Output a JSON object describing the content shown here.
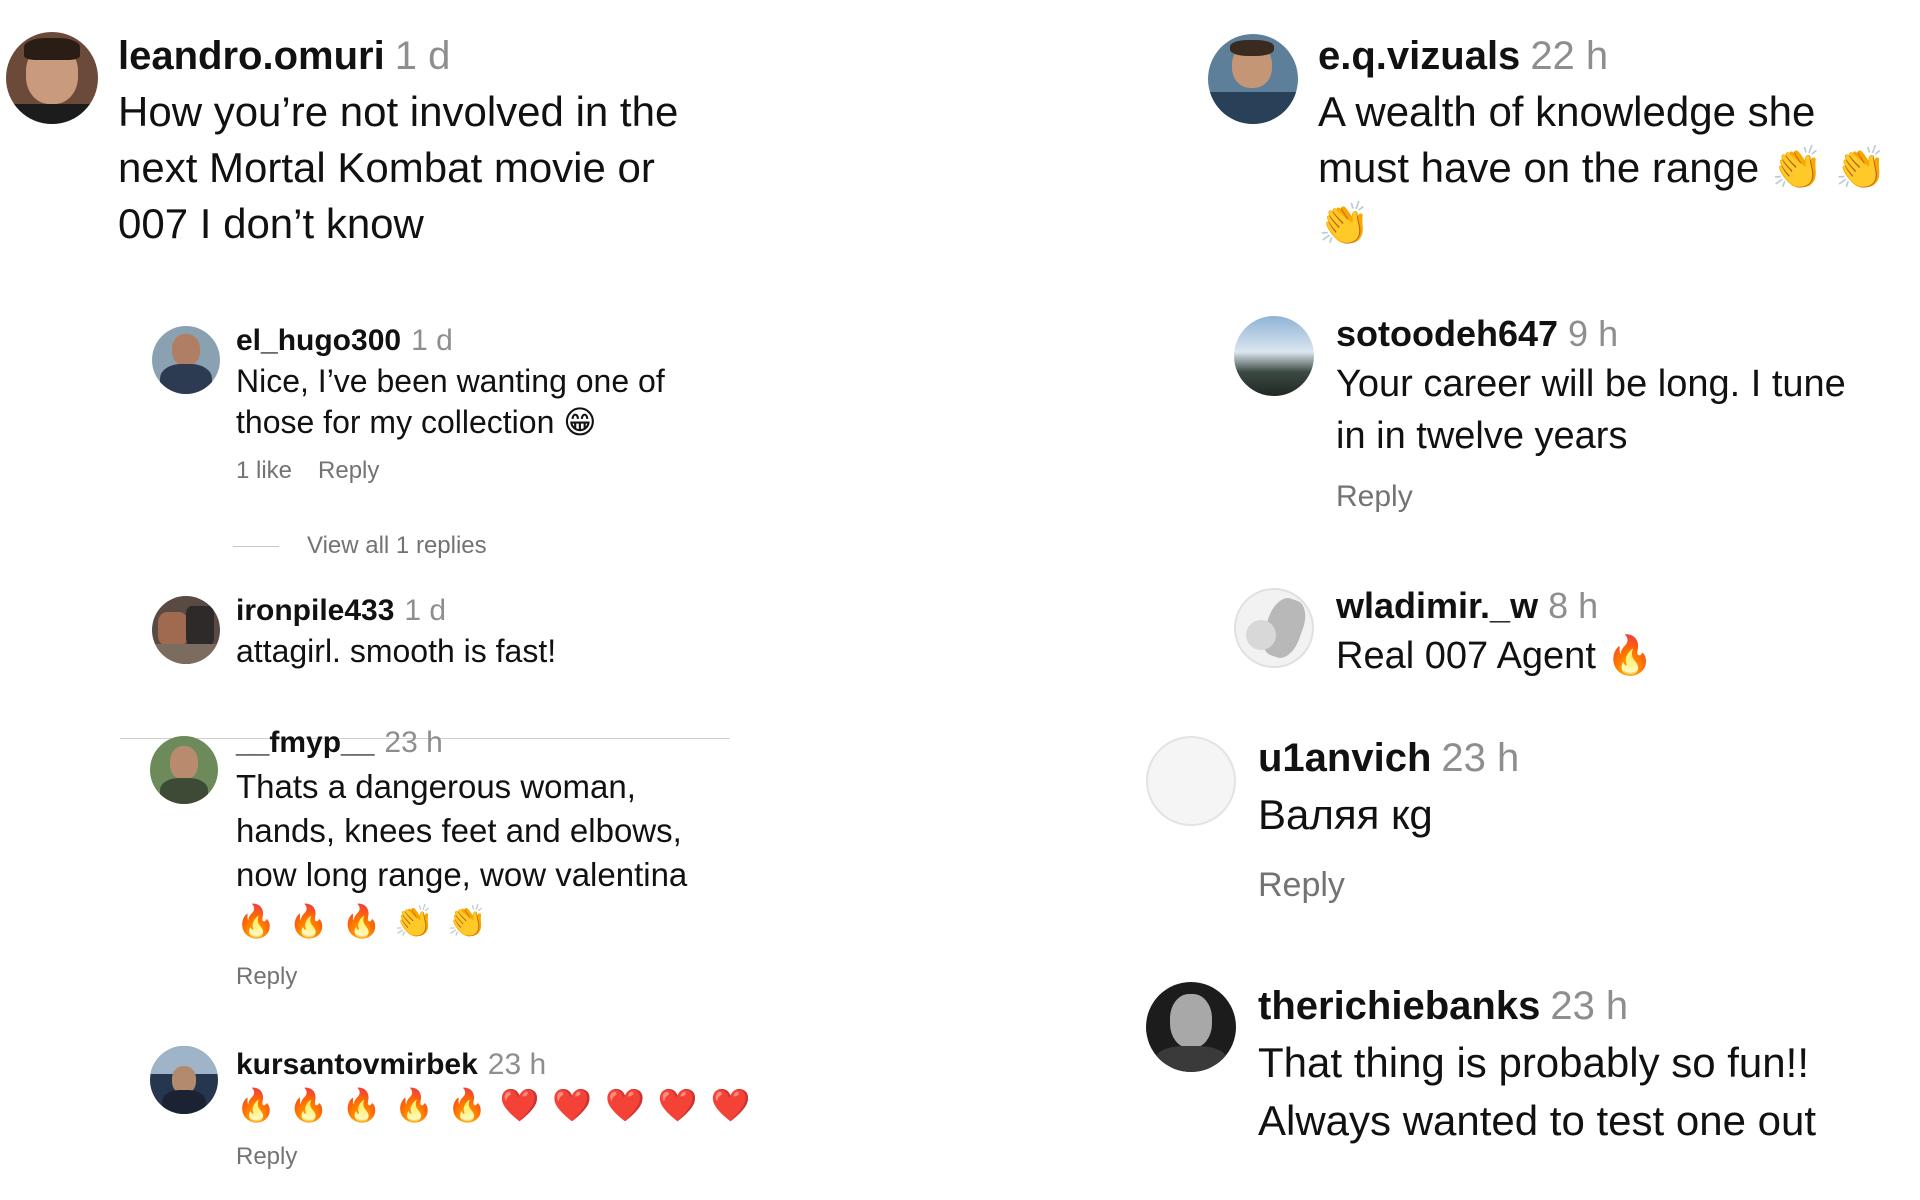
{
  "left_column": {
    "c1": {
      "username": "leandro.omuri",
      "time": "1 d",
      "text": "How you’re not involved in the\nnext Mortal Kombat movie or\n007 I don’t know"
    },
    "c2": {
      "username": "el_hugo300",
      "time": "1 d",
      "text": "Nice, I’ve been wanting one of\nthose for my collection 😁",
      "likes": "1 like",
      "reply": "Reply",
      "view_replies": "View all 1 replies"
    },
    "c3": {
      "username": "ironpile433",
      "time": "1 d",
      "text": "attagirl. smooth is fast!"
    },
    "c4": {
      "username": "__fmyp__",
      "time": "23 h",
      "text": "Thats a dangerous woman,\nhands, knees feet and elbows,\nnow long range, wow valentina",
      "emojis": "🔥 🔥 🔥 👏 👏",
      "reply": "Reply"
    },
    "c5": {
      "username": "kursantovmirbek",
      "time": "23 h",
      "emojis": "🔥 🔥 🔥 🔥 🔥 ❤️ ❤️ ❤️ ❤️ ❤️",
      "reply": "Reply"
    }
  },
  "right_column": {
    "r1": {
      "username": "e.q.vizuals",
      "time": "22 h",
      "text": "A wealth of knowledge she\nmust have on the range 👏 👏\n👏"
    },
    "r2": {
      "username": "sotoodeh647",
      "time": "9 h",
      "text": "Your career will be long. I tune\nin in twelve years",
      "reply": "Reply"
    },
    "r3": {
      "username": "wladimir._w",
      "time": "8 h",
      "text": "Real 007 Agent 🔥"
    },
    "r4": {
      "username": "u1anvich",
      "time": "23 h",
      "text": "Валяя кg",
      "reply": "Reply"
    },
    "r5": {
      "username": "therichiebanks",
      "time": "23 h",
      "text": "That thing is probably so fun!!\nAlways wanted to test one out"
    }
  }
}
